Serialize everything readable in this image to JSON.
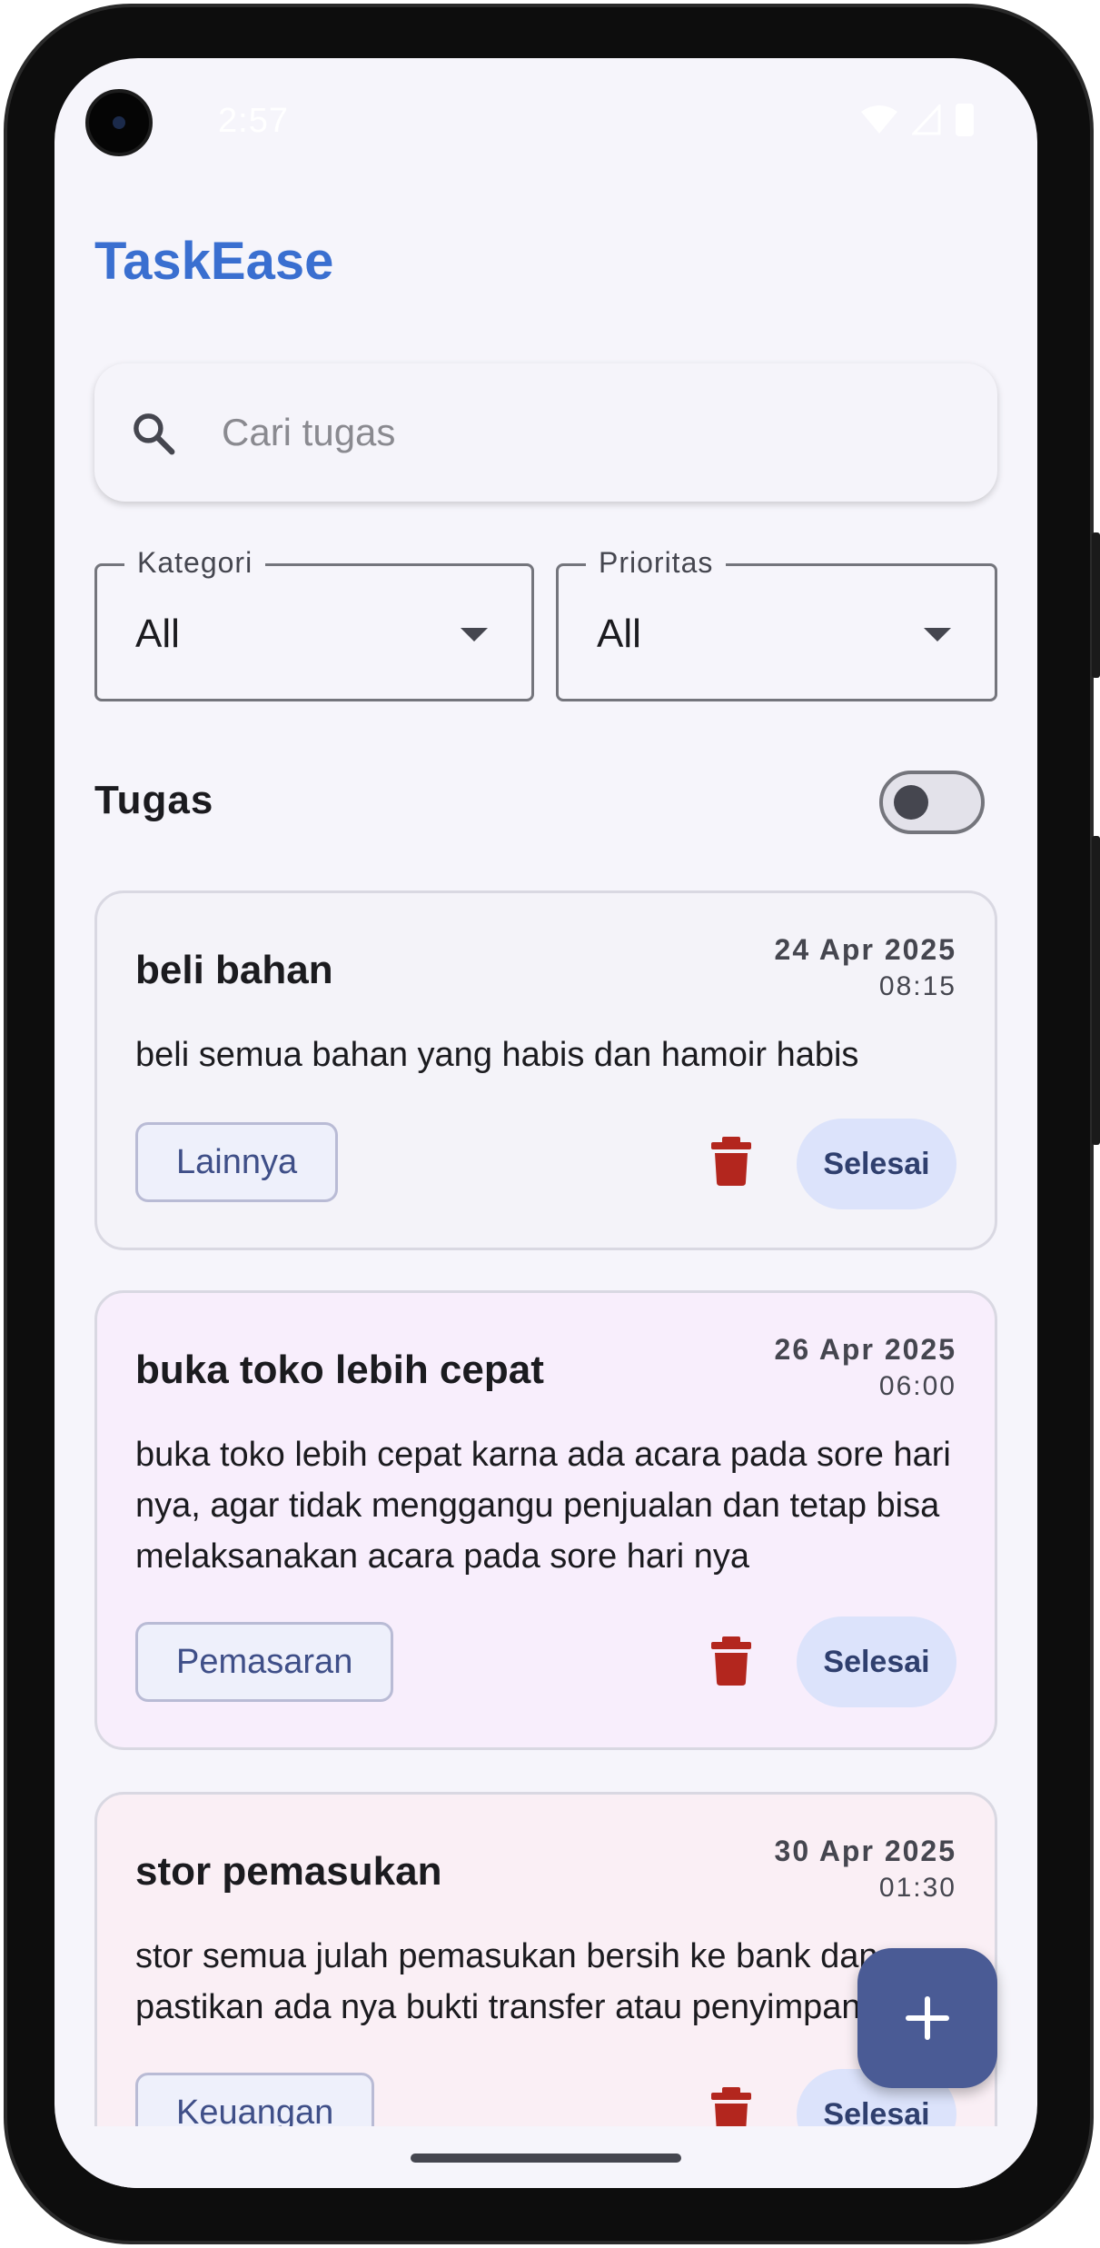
{
  "status_bar": {
    "time": "2:57"
  },
  "app": {
    "title": "TaskEase"
  },
  "search": {
    "placeholder": "Cari tugas",
    "value": ""
  },
  "filters": {
    "kategori": {
      "label": "Kategori",
      "value": "All"
    },
    "prioritas": {
      "label": "Prioritas",
      "value": "All"
    }
  },
  "section": {
    "title": "Tugas",
    "toggle_on": false
  },
  "tasks": [
    {
      "title": "beli bahan",
      "date": "24 Apr 2025",
      "time": "08:15",
      "description": "beli semua bahan yang habis dan hamoir habis",
      "category": "Lainnya",
      "action_label": "Selesai"
    },
    {
      "title": "buka toko lebih cepat",
      "date": "26 Apr 2025",
      "time": "06:00",
      "description": "buka toko lebih cepat karna ada acara pada sore hari nya, agar tidak menggangu penjualan dan tetap bisa melaksanakan acara pada sore hari nya",
      "category": "Pemasaran",
      "action_label": "Selesai"
    },
    {
      "title": "stor pemasukan",
      "date": "30 Apr 2025",
      "time": "01:30",
      "description": "stor semua julah pemasukan bersih ke bank dan pastikan ada nya bukti transfer atau penyimpanan",
      "category": "Keuangan",
      "action_label": "Selesai"
    }
  ],
  "colors": {
    "brand": "#3a6fd0",
    "delete": "#b3261e",
    "fab": "#4a5b95",
    "done_button": "#dce3fb"
  },
  "icons": {
    "search": "search-icon",
    "dropdown": "arrow-drop-down-icon",
    "delete": "trash-icon",
    "fab": "plus-icon"
  }
}
